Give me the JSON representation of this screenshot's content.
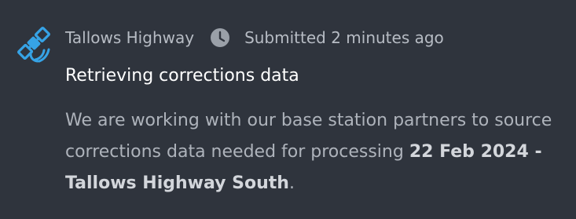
{
  "notification": {
    "icon": "satellite-icon",
    "clock_icon": "clock-icon",
    "site_name": "Tallows Highway",
    "submitted_text": "Submitted 2 minutes ago",
    "title": "Retrieving corrections data",
    "description_prefix": "We are working with our base station partners to source corrections data needed for processing ",
    "description_bold": "22 Feb 2024 - Tallows Highway South",
    "description_suffix": "."
  },
  "colors": {
    "background": "#2f343d",
    "accent": "#36a3e6",
    "title": "#ffffff",
    "meta": "#b7bcc4",
    "body": "#aeb3bb"
  }
}
